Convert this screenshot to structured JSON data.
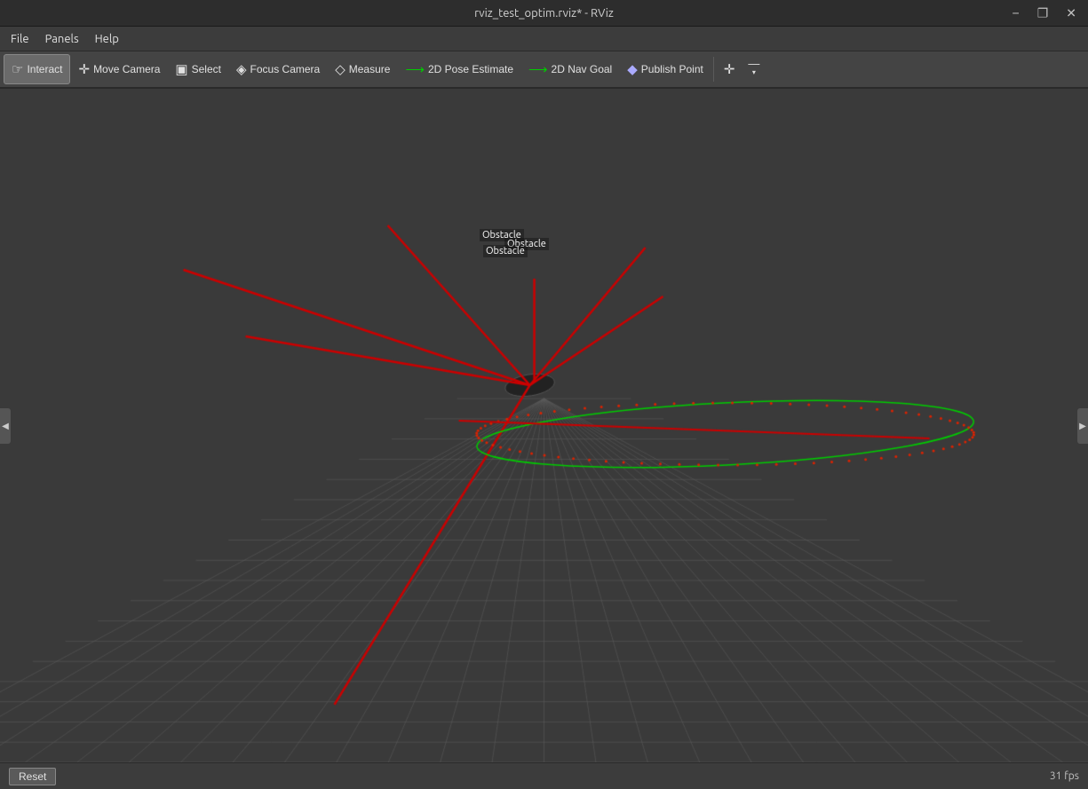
{
  "titlebar": {
    "title": "rviz_test_optim.rviz* - RViz",
    "minimize": "−",
    "restore": "❐",
    "close": "✕"
  },
  "menubar": {
    "items": [
      "File",
      "Panels",
      "Help"
    ]
  },
  "toolbar": {
    "buttons": [
      {
        "id": "interact",
        "label": "Interact",
        "icon": "☞",
        "active": true
      },
      {
        "id": "move-camera",
        "label": "Move Camera",
        "icon": "✛",
        "active": false
      },
      {
        "id": "select",
        "label": "Select",
        "icon": "▣",
        "active": false
      },
      {
        "id": "focus-camera",
        "label": "Focus Camera",
        "icon": "◈",
        "active": false
      },
      {
        "id": "measure",
        "label": "Measure",
        "icon": "◇",
        "active": false
      },
      {
        "id": "pose-estimate",
        "label": "2D Pose Estimate",
        "icon": "→",
        "active": false,
        "color": "#00cc00"
      },
      {
        "id": "nav-goal",
        "label": "2D Nav Goal",
        "icon": "→",
        "active": false,
        "color": "#00cc00"
      },
      {
        "id": "publish-point",
        "label": "Publish Point",
        "icon": "◆",
        "active": false,
        "color": "#aaaaff"
      }
    ],
    "add_icon": "✛",
    "more_icon": "−",
    "more_arrow": "▾"
  },
  "viewport": {
    "obstacle_labels": [
      "Obstacle",
      "Obstacle",
      "Obstacle"
    ]
  },
  "statusbar": {
    "reset_label": "Reset",
    "fps_label": "31 fps"
  },
  "colors": {
    "background": "#3a3a3a",
    "grid_line": "#5a5a5a",
    "red_line": "#cc0000",
    "green_path": "#00cc00",
    "red_dots": "#cc2200"
  }
}
